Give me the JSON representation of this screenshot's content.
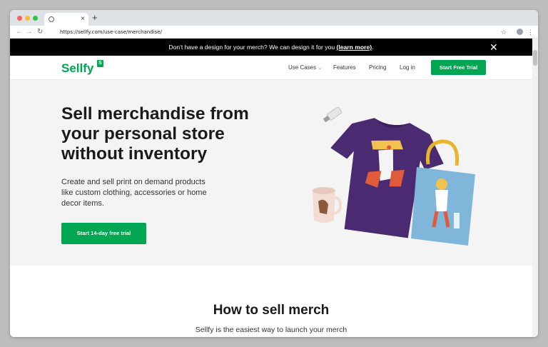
{
  "browser": {
    "tab_close": "×",
    "new_tab": "+",
    "back": "←",
    "forward": "→",
    "reload": "↻",
    "url": "https://sellfy.com/use-case/merchandise/",
    "star": "☆",
    "menu": "⋮"
  },
  "banner": {
    "text": "Don't have a design for your merch? We can design it for you ",
    "link_text": "(learn more)",
    "suffix": ".",
    "close": "✕"
  },
  "nav": {
    "logo": "Sellfy",
    "logo_badge": "S",
    "links": [
      "Use Cases",
      "Features",
      "Pricing",
      "Log in"
    ],
    "use_cases_caret": "⌄",
    "cta": "Start Free Trial"
  },
  "hero": {
    "title_lines": [
      "Sell merchandise from",
      "your personal store",
      "without inventory"
    ],
    "subtitle_lines": [
      "Create and sell print on demand products",
      "like custom clothing, accessories or home",
      "decor items."
    ],
    "cta": "Start 14-day free trial"
  },
  "section": {
    "title": "How to sell merch",
    "subtitle": "Sellfy is the easiest way to launch your merch"
  },
  "colors": {
    "brand_green": "#00a651",
    "banner_bg": "#000000",
    "hero_bg": "#f4f4f4",
    "tshirt": "#4a2a70",
    "tote": "#7fb6d9",
    "tote_handle": "#e8b52a"
  }
}
